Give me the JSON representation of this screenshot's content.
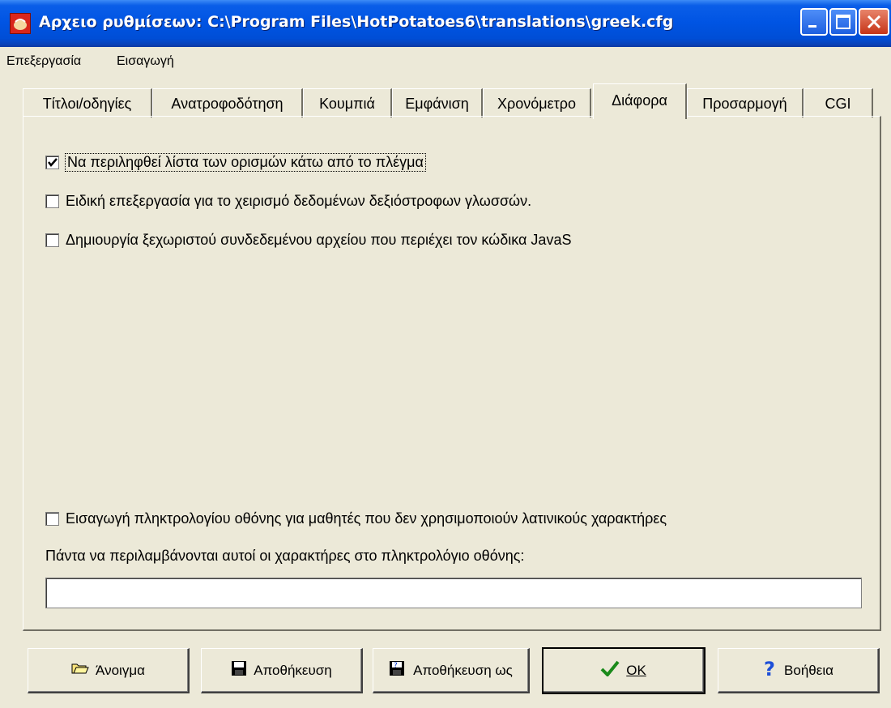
{
  "window": {
    "title": "Αρχειο ρυθμίσεων:  C:\\Program Files\\HotPotatoes6\\translations\\greek.cfg"
  },
  "menu": {
    "items": [
      "Επεξεργασία",
      "Εισαγωγή"
    ]
  },
  "tabs": [
    "Τίτλοι/οδηγίες",
    "Ανατροφοδότηση",
    "Κουμπιά",
    "Εμφάνιση",
    "Χρονόμετρο",
    "Διάφορα",
    "Προσαρμογή",
    "CGI"
  ],
  "active_tab": "Διάφορα",
  "options": {
    "include_list": {
      "label": "Να περιληφθεί λίστα των ορισμών κάτω από το πλέγμα",
      "checked": true
    },
    "rtl_processing": {
      "label": "Ειδική επεξεργασία για το χειρισμό δεδομένων δεξιόστροφων γλωσσών.",
      "checked": false
    },
    "separate_js": {
      "label": "Δημιουργία ξεχωριστού συνδεδεμένου αρχείου που περιέχει τον κώδικα JavaS",
      "checked": false
    },
    "screen_keyboard": {
      "label": "Εισαγωγή πληκτρολογίου οθόνης για μαθητές που δεν χρησιμοποιούν λατινικούς χαρακτήρες",
      "checked": false
    }
  },
  "keyboard_chars": {
    "label": "Πάντα να περιλαμβάνονται αυτοί οι χαρακτήρες στο πληκτρολόγιο οθόνης:",
    "value": ""
  },
  "buttons": {
    "open": "Άνοιγμα",
    "save": "Αποθήκευση",
    "save_as": "Αποθήκευση ως",
    "ok": "OK",
    "help": "Βοήθεια"
  },
  "colors": {
    "titlebar": "#0054e3",
    "face": "#ece9d8",
    "close": "#c63417"
  }
}
